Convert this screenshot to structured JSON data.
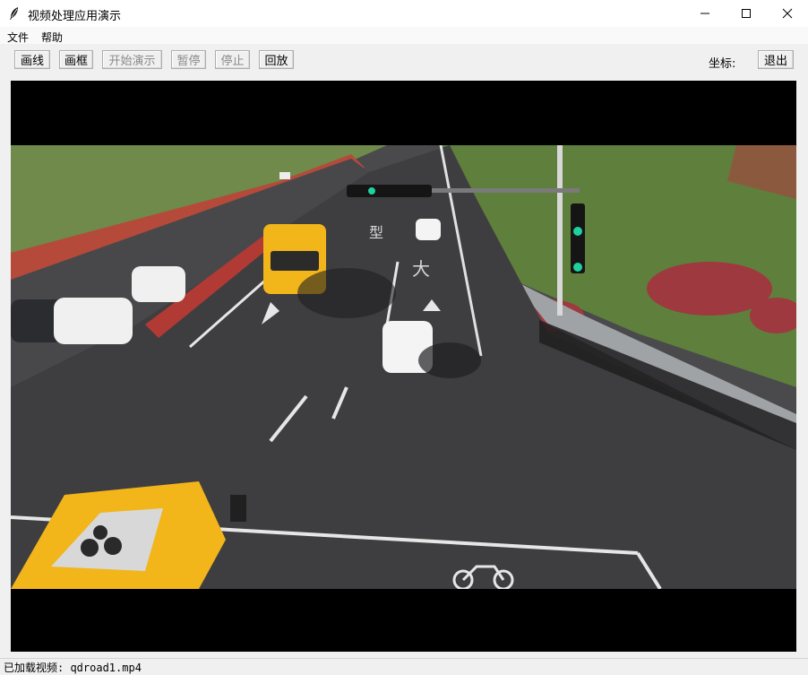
{
  "window": {
    "title": "视频处理应用演示"
  },
  "menu": {
    "items": [
      "文件",
      "帮助"
    ]
  },
  "toolbar": {
    "draw_line": "画线",
    "draw_box": "画框",
    "start_demo": "开始演示",
    "pause": "暂停",
    "stop": "停止",
    "replay": "回放",
    "coord_label": "坐标:",
    "exit": "退出"
  },
  "video": {
    "road_markings": [
      "型",
      "大"
    ]
  },
  "status": {
    "text": "已加载视频: qdroad1.mp4"
  },
  "colors": {
    "disabled_text": "#8a8a8a",
    "video_bg": "#000000",
    "road": "#3e3e40",
    "bus_yellow": "#f2b51a"
  }
}
